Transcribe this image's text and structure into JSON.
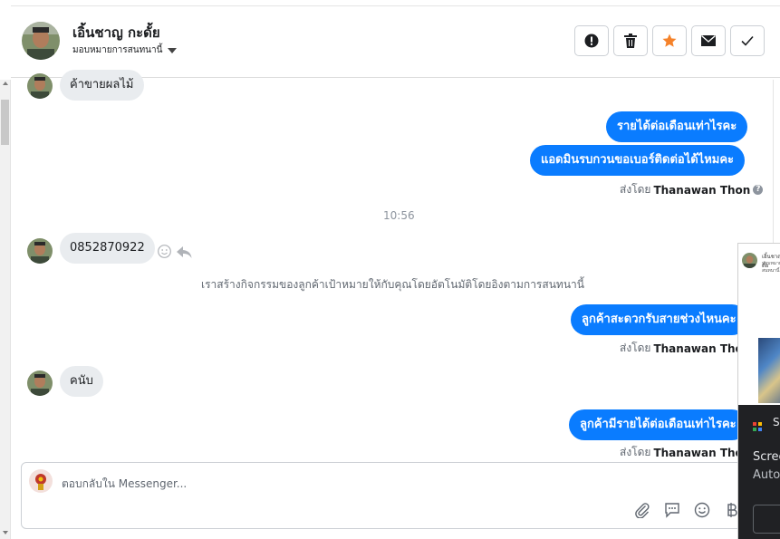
{
  "header": {
    "contact_name": "เอิ้นชาญ กะดั้ย",
    "assign_label": "มอบหมายการสนทนานี้",
    "buttons": [
      "spam",
      "delete",
      "star",
      "mark-unread",
      "done"
    ]
  },
  "messages": {
    "in_1": "ค้าขายผลไม้",
    "out_1": "รายได้ต่อเดือนเท่าไรคะ",
    "out_2": "แอดมินรบกวนขอเบอร์ติดต่อได้ไหมคะ",
    "sent_by_prefix": "ส่งโดย",
    "sender_name": "Thanawan Thon",
    "timestamp": "10:56",
    "in_2": "0852870922",
    "system_note": "เราสร้างกิจกรรมของลูกค้าเป้าหมายให้กับคุณโดยอัตโนมัติโดยอิงตามการสนทนานี้",
    "out_3": "ลูกค้าสะดวกรับสายช่วงไหนคะ",
    "in_3": "คนับ",
    "out_4": "ลูกค้ามีรายได้ต่อเดือนเท่าไรคะ"
  },
  "composer": {
    "placeholder": "ตอบกลับใน Messenger..."
  },
  "popup": {
    "s_label": "S",
    "text_1": "Scree",
    "text_2": "Auto"
  },
  "colors": {
    "outgoing_bubble": "#0a7cff",
    "incoming_bubble": "#e9ecef",
    "star_accent": "#f5822a"
  }
}
